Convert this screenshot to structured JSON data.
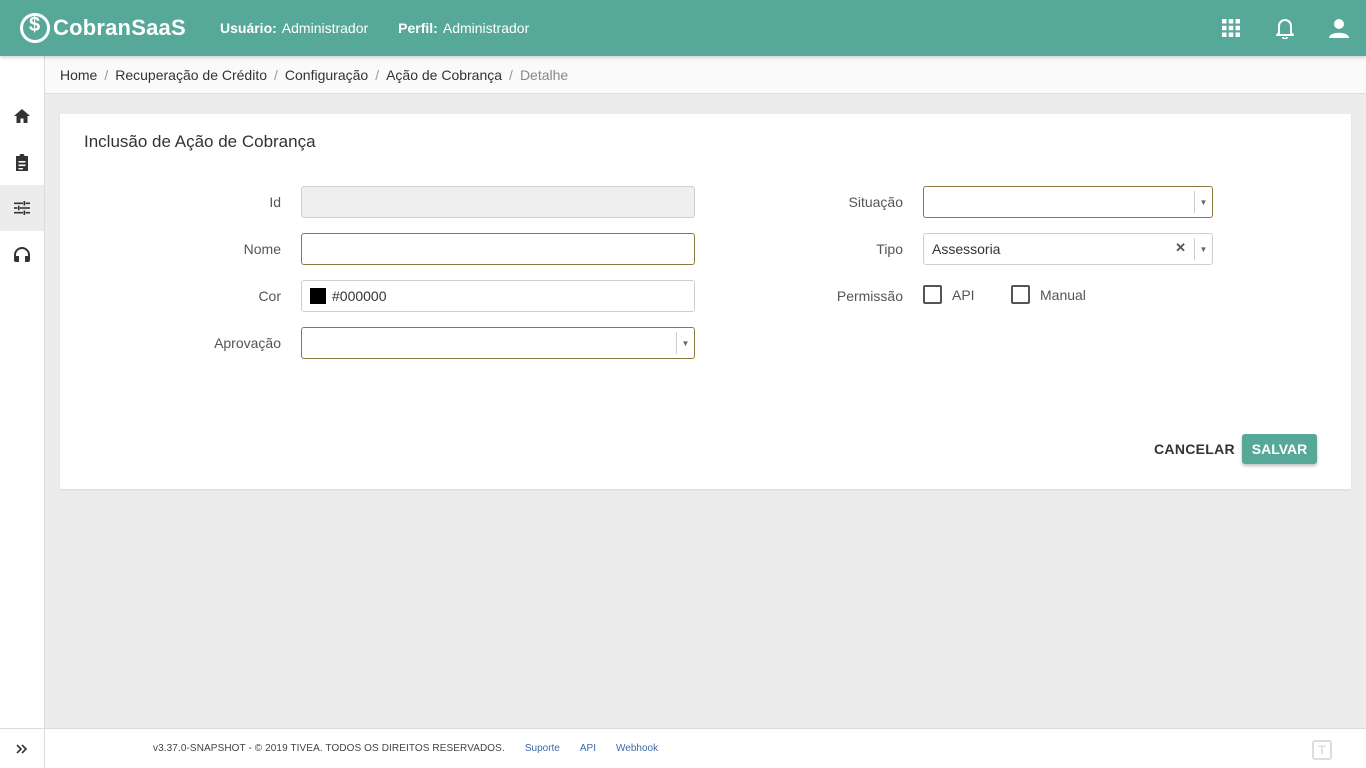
{
  "header": {
    "logo_text": "CobranSaaS",
    "user_label": "Usuário:",
    "user_value": "Administrador",
    "profile_label": "Perfil:",
    "profile_value": "Administrador",
    "icons": [
      "apps-grid-icon",
      "bell-icon",
      "user-icon"
    ]
  },
  "sidebar": {
    "items": [
      {
        "icon": "home-icon"
      },
      {
        "icon": "clipboard-icon"
      },
      {
        "icon": "sliders-icon",
        "active": true
      },
      {
        "icon": "headset-icon"
      }
    ],
    "expand_icon": "double-chevron-right-icon"
  },
  "breadcrumb": {
    "items": [
      "Home",
      "Recuperação de Crédito",
      "Configuração",
      "Ação de Cobrança"
    ],
    "current": "Detalhe",
    "separator": "/"
  },
  "form": {
    "title": "Inclusão de Ação de Cobrança",
    "id_label": "Id",
    "id_value": "",
    "nome_label": "Nome",
    "nome_value": "",
    "cor_label": "Cor",
    "cor_value": "#000000",
    "aprovacao_label": "Aprovação",
    "aprovacao_value": "",
    "situacao_label": "Situação",
    "situacao_value": "",
    "tipo_label": "Tipo",
    "tipo_value": "Assessoria",
    "permissao_label": "Permissão",
    "permissao_api": "API",
    "permissao_manual": "Manual",
    "cancel_label": "CANCELAR",
    "save_label": "SALVAR"
  },
  "footer": {
    "copyright": "v3.37.0-SNAPSHOT - © 2019 TIVEA. TODOS OS DIREITOS RESERVADOS.",
    "links": [
      "Suporte",
      "API",
      "Webhook"
    ]
  },
  "colors": {
    "primary": "#56a898",
    "input_border": "#8c7a3e",
    "link": "#3c6aa8"
  }
}
